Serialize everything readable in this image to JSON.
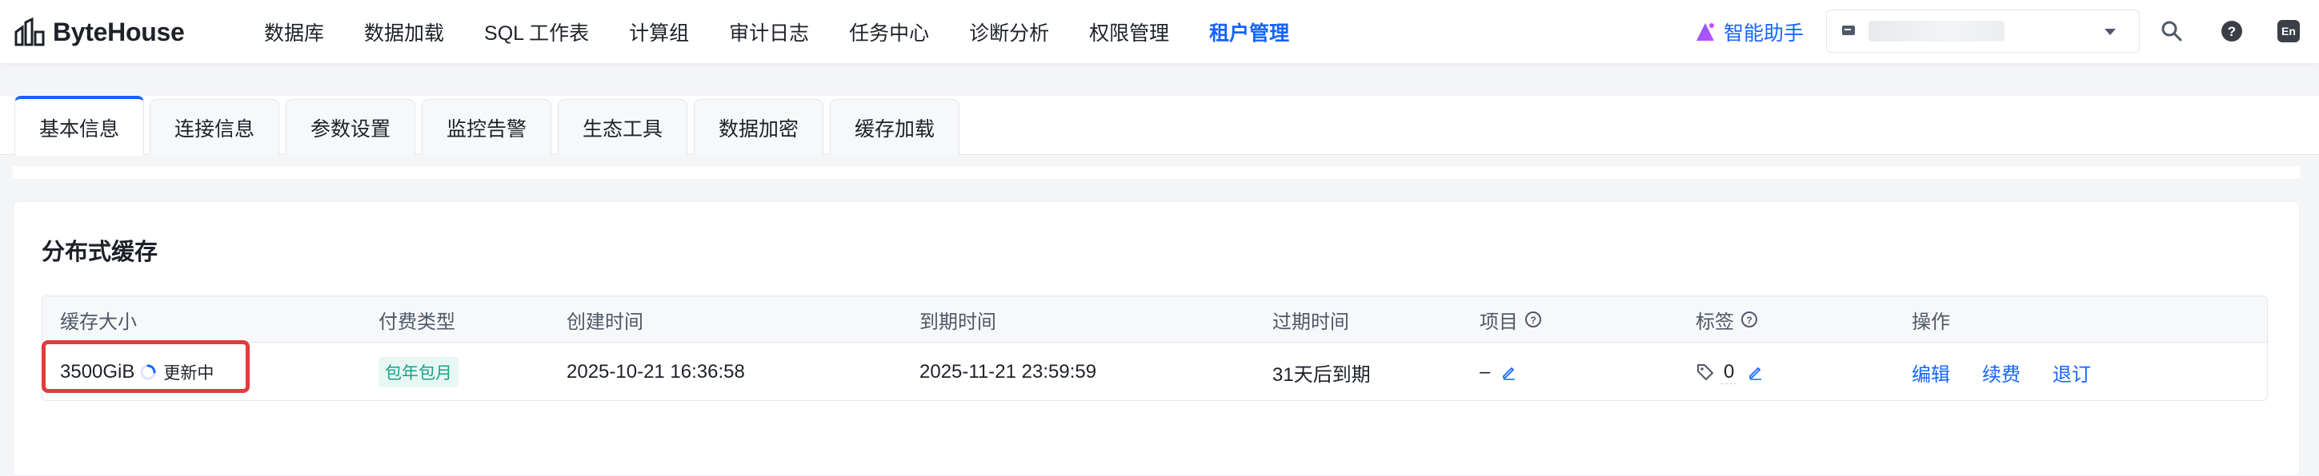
{
  "app": {
    "logo_text": "ByteHouse"
  },
  "nav": {
    "items": [
      "数据库",
      "数据加载",
      "SQL 工作表",
      "计算组",
      "审计日志",
      "任务中心",
      "诊断分析",
      "权限管理",
      "租户管理"
    ],
    "active_index": 8
  },
  "header": {
    "assistant_label": "智能助手",
    "language_badge": "En"
  },
  "tabs": {
    "items": [
      "基本信息",
      "连接信息",
      "参数设置",
      "监控告警",
      "生态工具",
      "数据加密",
      "缓存加载"
    ],
    "active_index": 0
  },
  "section": {
    "title": "分布式缓存"
  },
  "table": {
    "headers": {
      "size": "缓存大小",
      "billing": "付费类型",
      "created": "创建时间",
      "expires": "到期时间",
      "expiry_status": "过期时间",
      "project": "项目",
      "tags": "标签",
      "actions": "操作"
    },
    "row": {
      "size": "3500GiB",
      "status": "更新中",
      "billing": "包年包月",
      "created": "2025-10-21 16:36:58",
      "expires": "2025-11-21 23:59:59",
      "expiry_status": "31天后到期",
      "project": "–",
      "tag_count": "0",
      "actions": [
        "编辑",
        "续费",
        "退订"
      ]
    }
  },
  "colors": {
    "accent": "#1664ff",
    "highlight": "#e23b3b",
    "tag_text": "#14a38b",
    "tag_bg": "#e8f7f3"
  },
  "icons": [
    "bytehouse-logo-icon",
    "assistant-sparkle-icon",
    "workspace-icon",
    "chevron-down-icon",
    "search-icon",
    "help-icon",
    "pencil-icon",
    "tag-icon",
    "loading-spinner-icon"
  ]
}
